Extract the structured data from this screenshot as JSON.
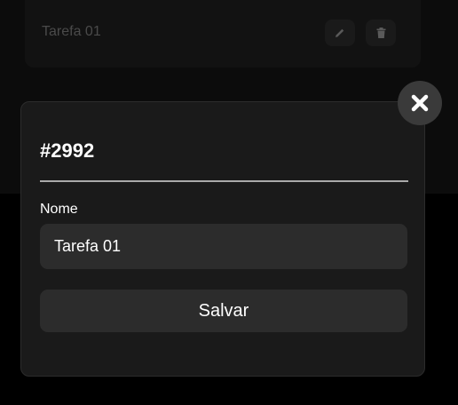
{
  "background": {
    "task_title": "Tarefa 01",
    "edit_icon": "pencil-icon",
    "delete_icon": "trash-icon"
  },
  "modal": {
    "title": "#2992",
    "field_label": "Nome",
    "field_value": "Tarefa 01",
    "save_label": "Salvar",
    "close_icon": "close-icon"
  },
  "colors": {
    "page_background": "#000000",
    "modal_background": "#1a1a1a",
    "input_background": "#2c2c2c",
    "close_button_background": "#3a3a3a",
    "divider": "#a9a9a9",
    "text": "#ffffff"
  }
}
